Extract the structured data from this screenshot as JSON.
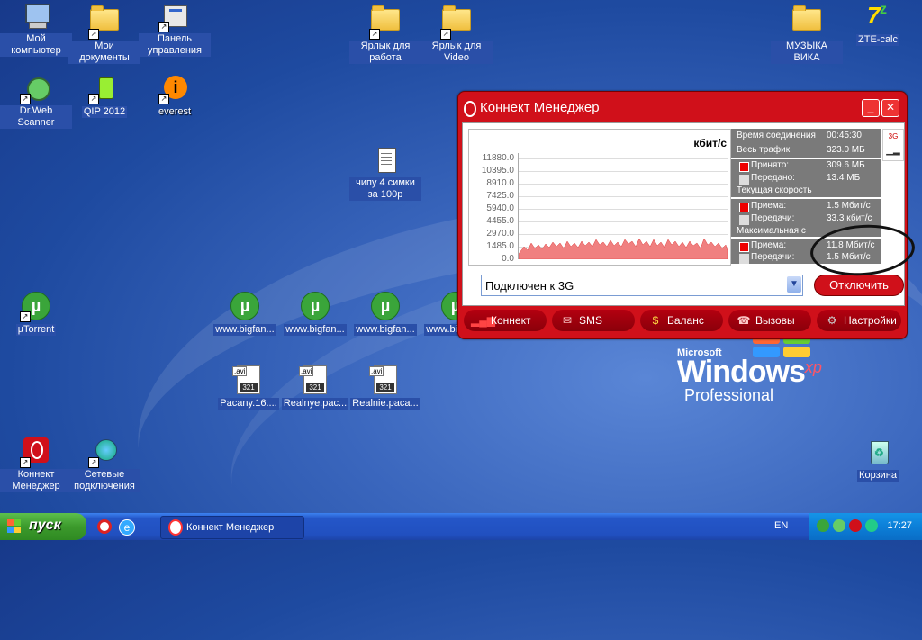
{
  "desktop": {
    "icons": {
      "my_computer": "Мой компьютер",
      "my_docs": "Мои документы",
      "control_panel": "Панель управления",
      "shortcut_work": "Ярлык для работа",
      "shortcut_video": "Ярлык для Video",
      "music": "МУЗЫКА ВИКА",
      "zte": "ZTE-calc",
      "drweb": "Dr.Web Scanner",
      "qip": "QIP 2012",
      "everest": "everest",
      "chipu": "чипу 4 симки за 100р",
      "utorrent": "µTorrent",
      "bigfan1": "www.bigfan...",
      "bigfan2": "www.bigfan...",
      "bigfan3": "www.bigfan...",
      "bigfan4": "www.bigfan...",
      "pacany": "Pacany.16....",
      "realnye": "Realnye.pac...",
      "realnie": "Realnie.paca...",
      "connect_manager": "Коннект Менеджер",
      "network": "Сетевые подключения",
      "recycle": "Корзина"
    },
    "xp_logo": {
      "microsoft": "Microsoft",
      "windows": "Windows",
      "xp": "xp",
      "edition": "Professional"
    }
  },
  "window": {
    "title": "Коннект Менеджер",
    "graph": {
      "unit": "кбит/с",
      "y_ticks": [
        "11880.0",
        "10395.0",
        "8910.0",
        "7425.0",
        "5940.0",
        "4455.0",
        "2970.0",
        "1485.0",
        "0.0"
      ]
    },
    "stats": {
      "conn_time_label": "Время соединения",
      "conn_time_value": "00:45:30",
      "traffic_label": "Весь трафик",
      "traffic_value": "323.0 МБ",
      "received_label": "Принято:",
      "received_value": "309.6 МБ",
      "sent_label": "Передано:",
      "sent_value": "13.4 МБ",
      "current_speed_label": "Текущая скорость",
      "cur_rx_label": "Приема:",
      "cur_rx_value": "1.5 Мбит/с",
      "cur_tx_label": "Передачи:",
      "cur_tx_value": "33.3 кбит/с",
      "max_speed_label": "Максимальная с",
      "max_rx_label": "Приема:",
      "max_rx_value": "11.8 Мбит/с",
      "max_tx_label": "Передачи:",
      "max_tx_value": "1.5 Мбит/с"
    },
    "indicator": "3G",
    "connection_select": "Подключен к 3G",
    "disconnect_button": "Отключить",
    "nav": {
      "connect": "Коннект",
      "sms": "SMS",
      "balance": "Баланс",
      "calls": "Вызовы",
      "settings": "Настройки"
    }
  },
  "taskbar": {
    "start": "пуск",
    "task": "Коннект Менеджер",
    "lang": "EN",
    "clock": "17:27"
  }
}
